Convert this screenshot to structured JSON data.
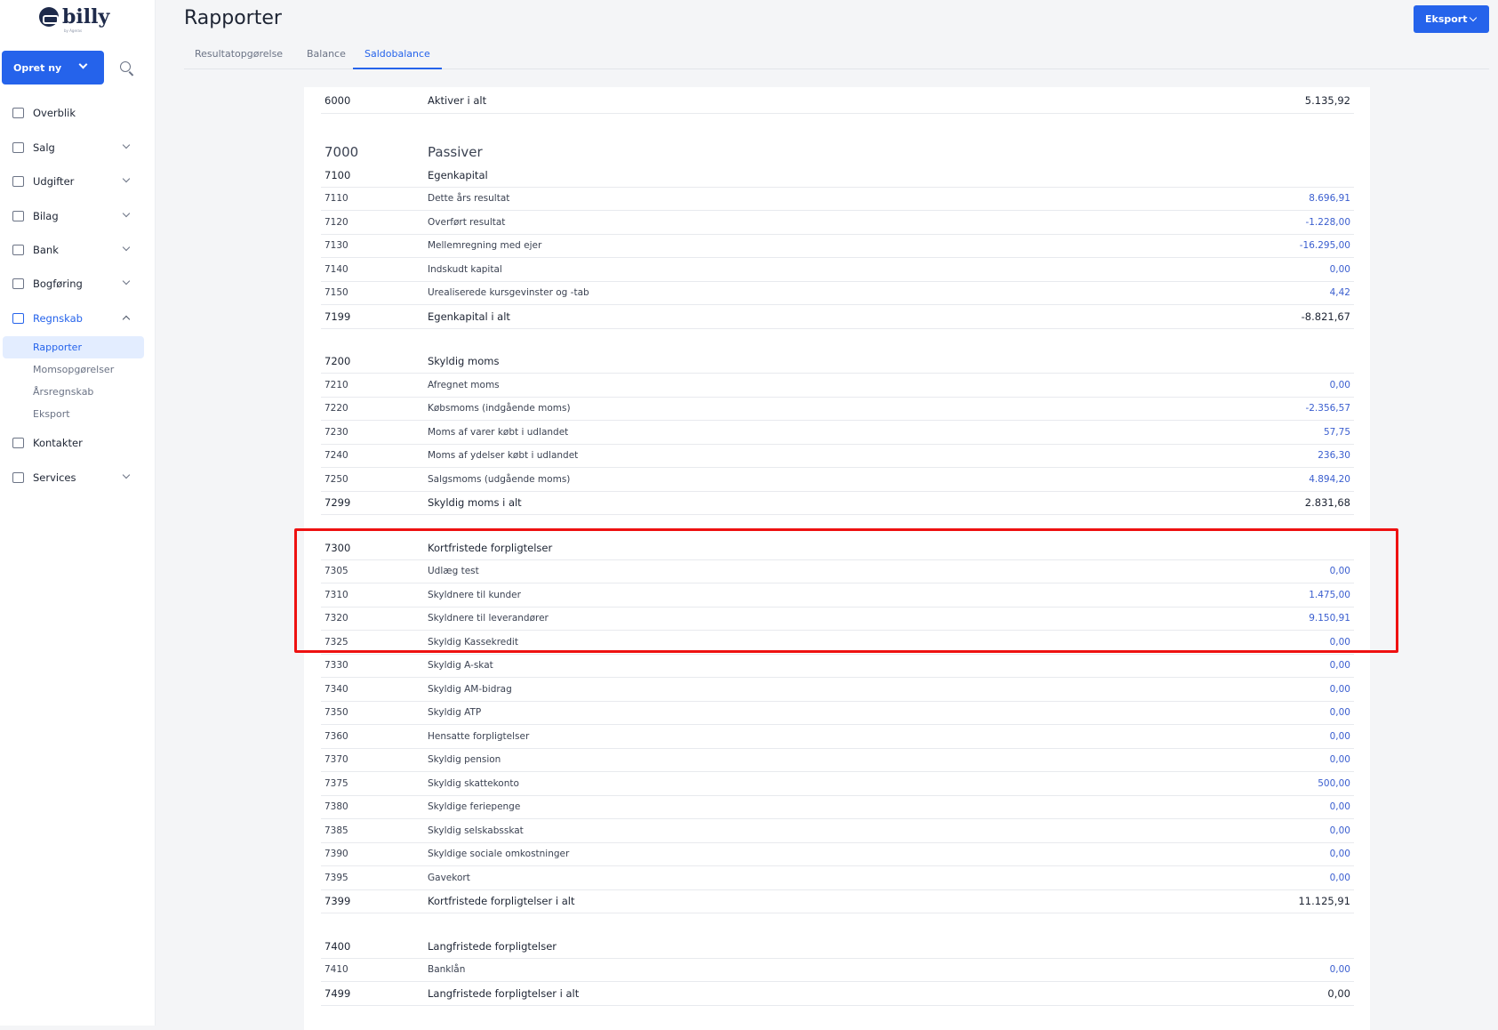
{
  "brand": {
    "name": "billy",
    "sub": "by Ageras"
  },
  "sidebar": {
    "create_label": "Opret ny",
    "items": [
      {
        "label": "Overblik",
        "icon": "monitor-icon",
        "chevron": false
      },
      {
        "label": "Salg",
        "icon": "wallet-icon",
        "chevron": true
      },
      {
        "label": "Udgifter",
        "icon": "receipt-icon",
        "chevron": true
      },
      {
        "label": "Bilag",
        "icon": "image-icon",
        "chevron": true
      },
      {
        "label": "Bank",
        "icon": "bank-icon",
        "chevron": true
      },
      {
        "label": "Bogføring",
        "icon": "calculator-icon",
        "chevron": true
      },
      {
        "label": "Regnskab",
        "icon": "report-icon",
        "chevron": "up",
        "active": true
      },
      {
        "label": "Kontakter",
        "icon": "user-icon",
        "chevron": false
      },
      {
        "label": "Services",
        "icon": "puzzle-icon",
        "chevron": true
      }
    ],
    "subitems": [
      {
        "label": "Rapporter",
        "active": true
      },
      {
        "label": "Momsopgørelser"
      },
      {
        "label": "Årsregnskab"
      },
      {
        "label": "Eksport"
      }
    ]
  },
  "header": {
    "title": "Rapporter",
    "export_label": "Eksport",
    "tabs": [
      {
        "label": "Resultatopgørelse"
      },
      {
        "label": "Balance"
      },
      {
        "label": "Saldobalance",
        "active": true
      }
    ]
  },
  "colors": {
    "accent": "#2563eb",
    "value_link": "#3a5ecf",
    "highlight": "#ee1111"
  },
  "table": {
    "rows": [
      {
        "code": "6000",
        "name": "Aktiver i alt",
        "value": "5.135,92",
        "type": "total first"
      },
      {
        "code": "7000",
        "name": "Passiver",
        "value": "",
        "type": "top bigGap"
      },
      {
        "code": "7100",
        "name": "Egenkapital",
        "value": "",
        "type": "header"
      },
      {
        "code": "7110",
        "name": "Dette års resultat",
        "value": "8.696,91"
      },
      {
        "code": "7120",
        "name": "Overført resultat",
        "value": "-1.228,00"
      },
      {
        "code": "7130",
        "name": "Mellemregning med ejer",
        "value": "-16.295,00"
      },
      {
        "code": "7140",
        "name": "Indskudt kapital",
        "value": "0,00"
      },
      {
        "code": "7150",
        "name": "Urealiserede kursgevinster og -tab",
        "value": "4,42"
      },
      {
        "code": "7199",
        "name": "Egenkapital i alt",
        "value": "-8.821,67",
        "type": "total"
      },
      {
        "code": "7200",
        "name": "Skyldig moms",
        "value": "",
        "type": "header gap"
      },
      {
        "code": "7210",
        "name": "Afregnet moms",
        "value": "0,00"
      },
      {
        "code": "7220",
        "name": "Købsmoms (indgående moms)",
        "value": "-2.356,57"
      },
      {
        "code": "7230",
        "name": "Moms af varer købt i udlandet",
        "value": "57,75"
      },
      {
        "code": "7240",
        "name": "Moms af ydelser købt i udlandet",
        "value": "236,30"
      },
      {
        "code": "7250",
        "name": "Salgsmoms (udgående moms)",
        "value": "4.894,20"
      },
      {
        "code": "7299",
        "name": "Skyldig moms i alt",
        "value": "2.831,68",
        "type": "total"
      },
      {
        "code": "7300",
        "name": "Kortfristede forpligtelser",
        "value": "",
        "type": "header gap"
      },
      {
        "code": "7305",
        "name": "Udlæg test",
        "value": "0,00"
      },
      {
        "code": "7310",
        "name": "Skyldnere til kunder",
        "value": "1.475,00"
      },
      {
        "code": "7320",
        "name": "Skyldnere til leverandører",
        "value": "9.150,91"
      },
      {
        "code": "7325",
        "name": "Skyldig Kassekredit",
        "value": "0,00"
      },
      {
        "code": "7330",
        "name": "Skyldig A-skat",
        "value": "0,00"
      },
      {
        "code": "7340",
        "name": "Skyldig AM-bidrag",
        "value": "0,00"
      },
      {
        "code": "7350",
        "name": "Skyldig ATP",
        "value": "0,00"
      },
      {
        "code": "7360",
        "name": "Hensatte forpligtelser",
        "value": "0,00"
      },
      {
        "code": "7370",
        "name": "Skyldig pension",
        "value": "0,00"
      },
      {
        "code": "7375",
        "name": "Skyldig skattekonto",
        "value": "500,00"
      },
      {
        "code": "7380",
        "name": "Skyldige feriepenge",
        "value": "0,00"
      },
      {
        "code": "7385",
        "name": "Skyldig selskabsskat",
        "value": "0,00"
      },
      {
        "code": "7390",
        "name": "Skyldige sociale omkostninger",
        "value": "0,00"
      },
      {
        "code": "7395",
        "name": "Gavekort",
        "value": "0,00"
      },
      {
        "code": "7399",
        "name": "Kortfristede forpligtelser i alt",
        "value": "11.125,91",
        "type": "total"
      },
      {
        "code": "7400",
        "name": "Langfristede forpligtelser",
        "value": "",
        "type": "header gap"
      },
      {
        "code": "7410",
        "name": "Banklån",
        "value": "0,00"
      },
      {
        "code": "7499",
        "name": "Langfristede forpligtelser i alt",
        "value": "0,00",
        "type": "total"
      }
    ]
  }
}
